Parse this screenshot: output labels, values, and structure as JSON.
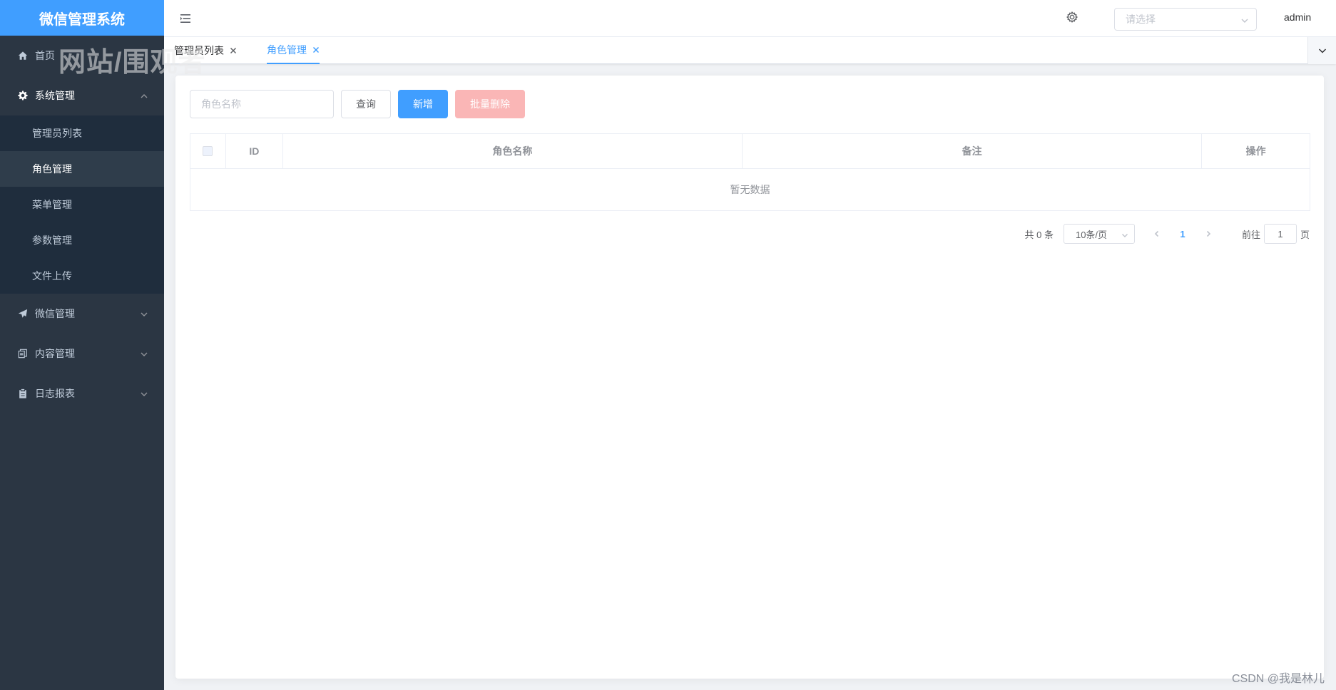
{
  "app": {
    "title": "微信管理系统"
  },
  "watermark": "网站/围观者",
  "sidebar": {
    "home": "首页",
    "system": {
      "label": "系统管理",
      "children": [
        "管理员列表",
        "角色管理",
        "菜单管理",
        "参数管理",
        "文件上传"
      ],
      "active": "角色管理"
    },
    "wechat": "微信管理",
    "content": "内容管理",
    "logs": "日志报表"
  },
  "header": {
    "select_placeholder": "请选择",
    "username": "admin"
  },
  "tabs": [
    {
      "label": "管理员列表",
      "active": false
    },
    {
      "label": "角色管理",
      "active": true
    }
  ],
  "toolbar": {
    "search_placeholder": "角色名称",
    "query_label": "查询",
    "add_label": "新增",
    "batch_delete_label": "批量删除"
  },
  "table": {
    "columns": [
      "ID",
      "角色名称",
      "备注",
      "操作"
    ],
    "empty_text": "暂无数据"
  },
  "pagination": {
    "total_text": "共 0 条",
    "page_size": "10条/页",
    "current_page": "1",
    "goto_label": "前往",
    "goto_value": "1",
    "page_suffix": "页"
  },
  "footer_mark": "CSDN @我是林儿",
  "colors": {
    "primary": "#409eff",
    "sidebar_bg": "#2b3643",
    "danger_disabled": "#fab6b6"
  }
}
